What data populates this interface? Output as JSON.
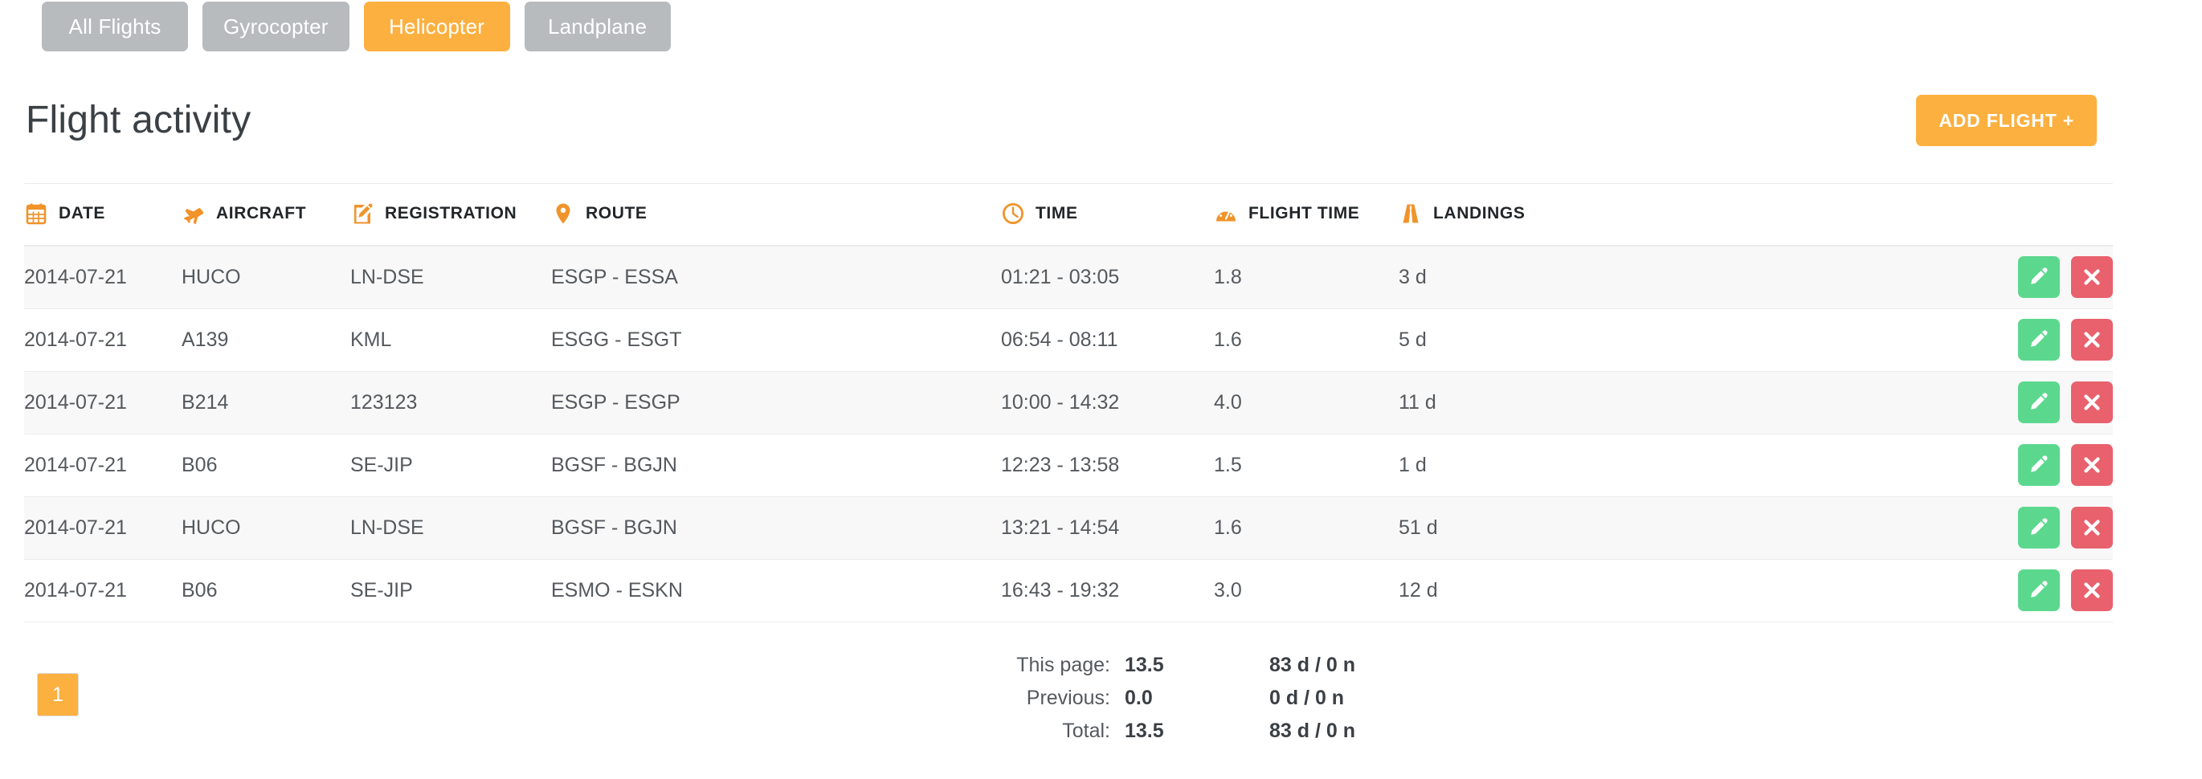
{
  "tabs": [
    {
      "label": "All Flights",
      "active": false
    },
    {
      "label": "Gyrocopter",
      "active": false
    },
    {
      "label": "Helicopter",
      "active": true
    },
    {
      "label": "Landplane",
      "active": false
    }
  ],
  "header": {
    "title": "Flight activity",
    "add_flight_label": "ADD FLIGHT +"
  },
  "table": {
    "columns": [
      {
        "label": "DATE",
        "icon": "calendar-icon"
      },
      {
        "label": "AIRCRAFT",
        "icon": "airplane-icon"
      },
      {
        "label": "REGISTRATION",
        "icon": "pencil-note-icon"
      },
      {
        "label": "ROUTE",
        "icon": "map-pin-icon"
      },
      {
        "label": "TIME",
        "icon": "clock-icon"
      },
      {
        "label": "FLIGHT TIME",
        "icon": "gauge-icon"
      },
      {
        "label": "LANDINGS",
        "icon": "runway-icon"
      }
    ],
    "rows": [
      {
        "date": "2014-07-21",
        "aircraft": "HUCO",
        "registration": "LN-DSE",
        "route": "ESGP - ESSA",
        "time": "01:21 - 03:05",
        "flight_time": "1.8",
        "landings": "3 d"
      },
      {
        "date": "2014-07-21",
        "aircraft": "A139",
        "registration": "KML",
        "route": "ESGG - ESGT",
        "time": "06:54 - 08:11",
        "flight_time": "1.6",
        "landings": "5 d"
      },
      {
        "date": "2014-07-21",
        "aircraft": "B214",
        "registration": "123123",
        "route": "ESGP - ESGP",
        "time": "10:00 - 14:32",
        "flight_time": "4.0",
        "landings": "11 d"
      },
      {
        "date": "2014-07-21",
        "aircraft": "B06",
        "registration": "SE-JIP",
        "route": "BGSF - BGJN",
        "time": "12:23 - 13:58",
        "flight_time": "1.5",
        "landings": "1 d"
      },
      {
        "date": "2014-07-21",
        "aircraft": "HUCO",
        "registration": "LN-DSE",
        "route": "BGSF - BGJN",
        "time": "13:21 - 14:54",
        "flight_time": "1.6",
        "landings": "51 d"
      },
      {
        "date": "2014-07-21",
        "aircraft": "B06",
        "registration": "SE-JIP",
        "route": "ESMO - ESKN",
        "time": "16:43 - 19:32",
        "flight_time": "3.0",
        "landings": "12 d"
      }
    ],
    "row_actions": {
      "edit_icon": "pencil-icon",
      "delete_icon": "close-x-icon"
    }
  },
  "pagination": {
    "pages": [
      "1"
    ],
    "current": "1"
  },
  "totals": [
    {
      "label": "This page:",
      "flight_time": "13.5",
      "landings": "83 d / 0 n"
    },
    {
      "label": "Previous:",
      "flight_time": "0.0",
      "landings": "0 d / 0 n"
    },
    {
      "label": "Total:",
      "flight_time": "13.5",
      "landings": "83 d / 0 n"
    }
  ],
  "colors": {
    "accent_orange": "#fcb040",
    "tab_gray": "#b7bbbe",
    "edit_green": "#5cd88e",
    "delete_red": "#e8616d",
    "text_dark": "#3b4045",
    "text_body": "#55595d",
    "row_stripe": "#f8f8f8",
    "border": "#ebebeb"
  }
}
